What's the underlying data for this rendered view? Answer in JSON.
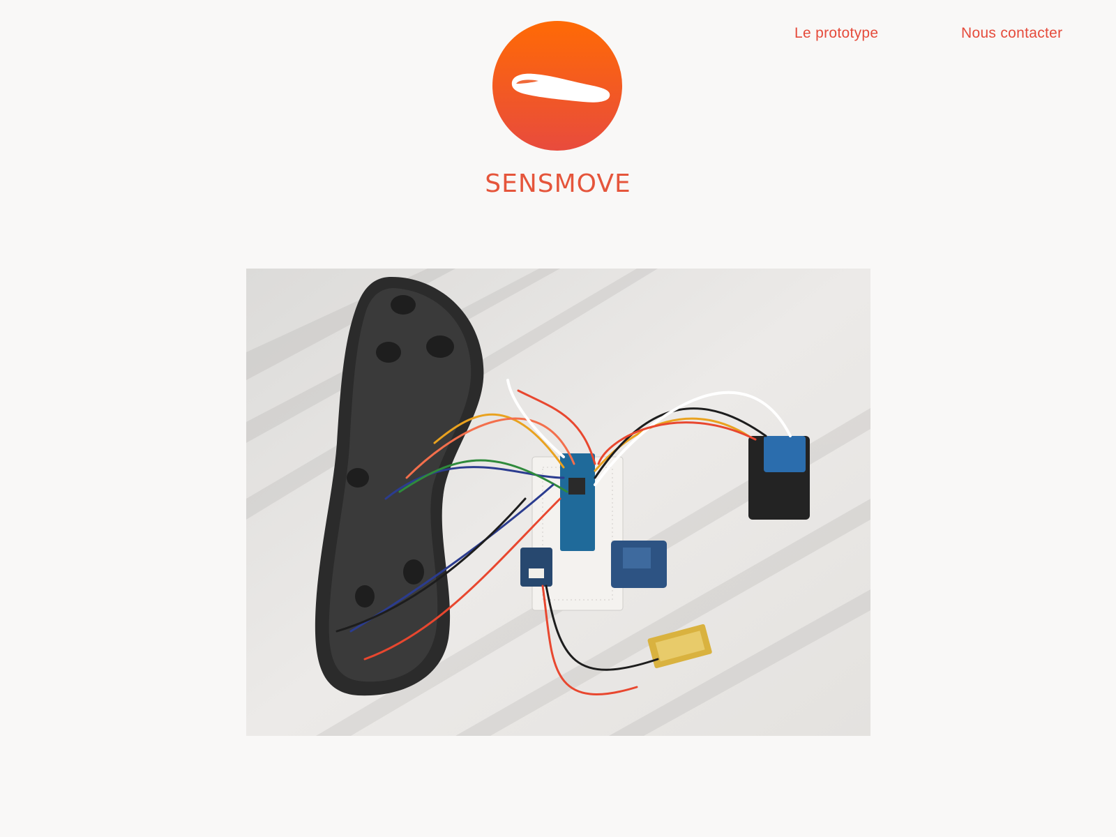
{
  "nav": {
    "prototype_label": "Le prototype",
    "contact_label": "Nous contacter"
  },
  "brand": {
    "name": "SENSMOVE",
    "logo_icon": "insole-logo-icon",
    "accent_color": "#e5553b",
    "logo_gradient_top": "#ff6a05",
    "logo_gradient_bottom": "#e84b3d"
  },
  "main": {
    "photo_icon": "prototype-photo"
  },
  "colors": {
    "background": "#f9f8f7",
    "nav_text": "#e54b3b"
  }
}
